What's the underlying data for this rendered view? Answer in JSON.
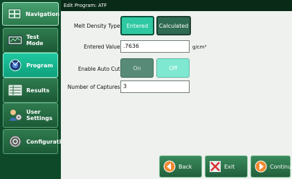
{
  "title": "Edit Program:  ATF",
  "sidebar": {
    "items": [
      {
        "label": "Navigation",
        "icon": "navigation-icon"
      },
      {
        "label": "Test Mode",
        "icon": "test-mode-icon"
      },
      {
        "label": "Program",
        "icon": "program-icon"
      },
      {
        "label": "Results",
        "icon": "results-icon"
      },
      {
        "label": "User Settings",
        "icon": "user-settings-icon"
      },
      {
        "label": "Configuration",
        "icon": "configuration-icon"
      }
    ]
  },
  "form": {
    "melt_density_type_label": "Melt Density Type:",
    "entered_label": "Entered",
    "calculated_label": "Calculated",
    "entered_value_label": "Entered Value:",
    "entered_value": ".7636",
    "entered_value_unit": "g/cm³",
    "enable_auto_cut_label": "Enable Auto Cut:",
    "on_label": "On",
    "off_label": "Off",
    "captures_label": "Number of Captures:",
    "captures_value": "3"
  },
  "actions": {
    "back": "Back",
    "exit": "Exit",
    "continue": "Continue"
  }
}
